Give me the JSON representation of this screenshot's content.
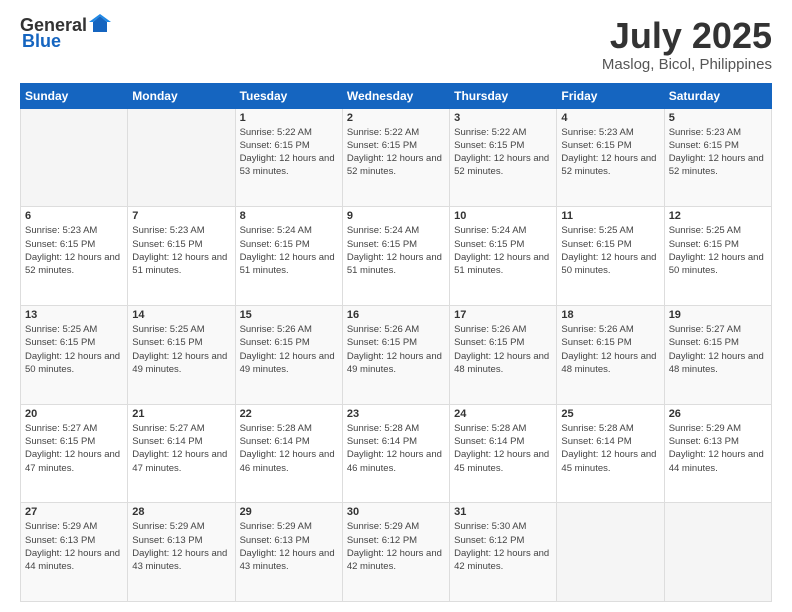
{
  "header": {
    "logo_general": "General",
    "logo_blue": "Blue",
    "month_title": "July 2025",
    "location": "Maslog, Bicol, Philippines"
  },
  "days_of_week": [
    "Sunday",
    "Monday",
    "Tuesday",
    "Wednesday",
    "Thursday",
    "Friday",
    "Saturday"
  ],
  "weeks": [
    [
      {
        "day": "",
        "sunrise": "",
        "sunset": "",
        "daylight": ""
      },
      {
        "day": "",
        "sunrise": "",
        "sunset": "",
        "daylight": ""
      },
      {
        "day": "1",
        "sunrise": "Sunrise: 5:22 AM",
        "sunset": "Sunset: 6:15 PM",
        "daylight": "Daylight: 12 hours and 53 minutes."
      },
      {
        "day": "2",
        "sunrise": "Sunrise: 5:22 AM",
        "sunset": "Sunset: 6:15 PM",
        "daylight": "Daylight: 12 hours and 52 minutes."
      },
      {
        "day": "3",
        "sunrise": "Sunrise: 5:22 AM",
        "sunset": "Sunset: 6:15 PM",
        "daylight": "Daylight: 12 hours and 52 minutes."
      },
      {
        "day": "4",
        "sunrise": "Sunrise: 5:23 AM",
        "sunset": "Sunset: 6:15 PM",
        "daylight": "Daylight: 12 hours and 52 minutes."
      },
      {
        "day": "5",
        "sunrise": "Sunrise: 5:23 AM",
        "sunset": "Sunset: 6:15 PM",
        "daylight": "Daylight: 12 hours and 52 minutes."
      }
    ],
    [
      {
        "day": "6",
        "sunrise": "Sunrise: 5:23 AM",
        "sunset": "Sunset: 6:15 PM",
        "daylight": "Daylight: 12 hours and 52 minutes."
      },
      {
        "day": "7",
        "sunrise": "Sunrise: 5:23 AM",
        "sunset": "Sunset: 6:15 PM",
        "daylight": "Daylight: 12 hours and 51 minutes."
      },
      {
        "day": "8",
        "sunrise": "Sunrise: 5:24 AM",
        "sunset": "Sunset: 6:15 PM",
        "daylight": "Daylight: 12 hours and 51 minutes."
      },
      {
        "day": "9",
        "sunrise": "Sunrise: 5:24 AM",
        "sunset": "Sunset: 6:15 PM",
        "daylight": "Daylight: 12 hours and 51 minutes."
      },
      {
        "day": "10",
        "sunrise": "Sunrise: 5:24 AM",
        "sunset": "Sunset: 6:15 PM",
        "daylight": "Daylight: 12 hours and 51 minutes."
      },
      {
        "day": "11",
        "sunrise": "Sunrise: 5:25 AM",
        "sunset": "Sunset: 6:15 PM",
        "daylight": "Daylight: 12 hours and 50 minutes."
      },
      {
        "day": "12",
        "sunrise": "Sunrise: 5:25 AM",
        "sunset": "Sunset: 6:15 PM",
        "daylight": "Daylight: 12 hours and 50 minutes."
      }
    ],
    [
      {
        "day": "13",
        "sunrise": "Sunrise: 5:25 AM",
        "sunset": "Sunset: 6:15 PM",
        "daylight": "Daylight: 12 hours and 50 minutes."
      },
      {
        "day": "14",
        "sunrise": "Sunrise: 5:25 AM",
        "sunset": "Sunset: 6:15 PM",
        "daylight": "Daylight: 12 hours and 49 minutes."
      },
      {
        "day": "15",
        "sunrise": "Sunrise: 5:26 AM",
        "sunset": "Sunset: 6:15 PM",
        "daylight": "Daylight: 12 hours and 49 minutes."
      },
      {
        "day": "16",
        "sunrise": "Sunrise: 5:26 AM",
        "sunset": "Sunset: 6:15 PM",
        "daylight": "Daylight: 12 hours and 49 minutes."
      },
      {
        "day": "17",
        "sunrise": "Sunrise: 5:26 AM",
        "sunset": "Sunset: 6:15 PM",
        "daylight": "Daylight: 12 hours and 48 minutes."
      },
      {
        "day": "18",
        "sunrise": "Sunrise: 5:26 AM",
        "sunset": "Sunset: 6:15 PM",
        "daylight": "Daylight: 12 hours and 48 minutes."
      },
      {
        "day": "19",
        "sunrise": "Sunrise: 5:27 AM",
        "sunset": "Sunset: 6:15 PM",
        "daylight": "Daylight: 12 hours and 48 minutes."
      }
    ],
    [
      {
        "day": "20",
        "sunrise": "Sunrise: 5:27 AM",
        "sunset": "Sunset: 6:15 PM",
        "daylight": "Daylight: 12 hours and 47 minutes."
      },
      {
        "day": "21",
        "sunrise": "Sunrise: 5:27 AM",
        "sunset": "Sunset: 6:14 PM",
        "daylight": "Daylight: 12 hours and 47 minutes."
      },
      {
        "day": "22",
        "sunrise": "Sunrise: 5:28 AM",
        "sunset": "Sunset: 6:14 PM",
        "daylight": "Daylight: 12 hours and 46 minutes."
      },
      {
        "day": "23",
        "sunrise": "Sunrise: 5:28 AM",
        "sunset": "Sunset: 6:14 PM",
        "daylight": "Daylight: 12 hours and 46 minutes."
      },
      {
        "day": "24",
        "sunrise": "Sunrise: 5:28 AM",
        "sunset": "Sunset: 6:14 PM",
        "daylight": "Daylight: 12 hours and 45 minutes."
      },
      {
        "day": "25",
        "sunrise": "Sunrise: 5:28 AM",
        "sunset": "Sunset: 6:14 PM",
        "daylight": "Daylight: 12 hours and 45 minutes."
      },
      {
        "day": "26",
        "sunrise": "Sunrise: 5:29 AM",
        "sunset": "Sunset: 6:13 PM",
        "daylight": "Daylight: 12 hours and 44 minutes."
      }
    ],
    [
      {
        "day": "27",
        "sunrise": "Sunrise: 5:29 AM",
        "sunset": "Sunset: 6:13 PM",
        "daylight": "Daylight: 12 hours and 44 minutes."
      },
      {
        "day": "28",
        "sunrise": "Sunrise: 5:29 AM",
        "sunset": "Sunset: 6:13 PM",
        "daylight": "Daylight: 12 hours and 43 minutes."
      },
      {
        "day": "29",
        "sunrise": "Sunrise: 5:29 AM",
        "sunset": "Sunset: 6:13 PM",
        "daylight": "Daylight: 12 hours and 43 minutes."
      },
      {
        "day": "30",
        "sunrise": "Sunrise: 5:29 AM",
        "sunset": "Sunset: 6:12 PM",
        "daylight": "Daylight: 12 hours and 42 minutes."
      },
      {
        "day": "31",
        "sunrise": "Sunrise: 5:30 AM",
        "sunset": "Sunset: 6:12 PM",
        "daylight": "Daylight: 12 hours and 42 minutes."
      },
      {
        "day": "",
        "sunrise": "",
        "sunset": "",
        "daylight": ""
      },
      {
        "day": "",
        "sunrise": "",
        "sunset": "",
        "daylight": ""
      }
    ]
  ]
}
